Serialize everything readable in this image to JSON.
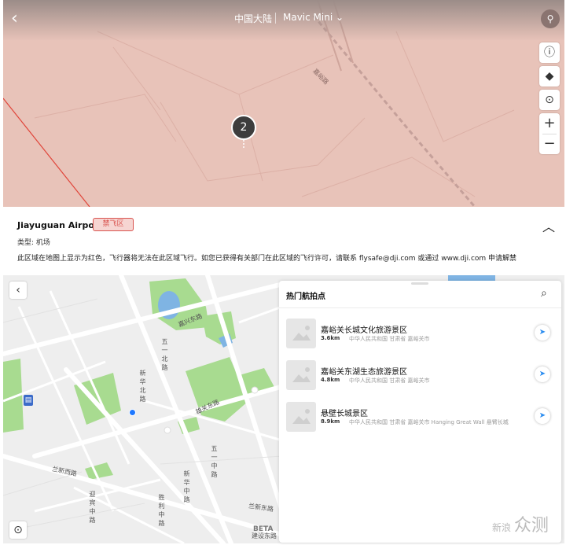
{
  "header": {
    "region": "中国大陆",
    "model": "Mavic Mini"
  },
  "top_map": {
    "cluster_count": "2",
    "road_label": "嘉峪路",
    "tools": [
      "info-icon",
      "layers-icon",
      "locate-icon",
      "zoom-in-icon",
      "zoom-out-icon"
    ],
    "zone_color": "#e7c2b8",
    "boundary_color": "#e0453a"
  },
  "info_panel": {
    "name": "Jiayuguan Airport",
    "badge": "禁飞区",
    "type_label": "类型:",
    "type_value": "机场",
    "description": "此区域在地图上显示为红色，飞行器将无法在此区域飞行。如您已获得有关部门在此区域的飞行许可，请联系 flysafe@dji.com 或通过 www.dji.com 申请解禁"
  },
  "bottom_map": {
    "roads": {
      "xingquan": "嘉兴东路",
      "wuyi_north": "五一北路",
      "xinhua_north": "新华北路",
      "jianguan": "雄关东路",
      "wuyi_middle": "五一中路",
      "xinhua_middle": "新华中路",
      "lanxin_west": "兰新西路",
      "shengli_middle": "胜利中路",
      "jiabin_middle": "迎宾中路",
      "lanxin_east": "兰新东路",
      "jianshe_east": "建设东路"
    },
    "beta_label": "BETA"
  },
  "hot_spots": {
    "title": "热门航拍点",
    "items": [
      {
        "name": "嘉峪关长城文化旅游景区",
        "distance": "3.6km",
        "location": "中华人民共和国 甘肃省 嘉峪关市"
      },
      {
        "name": "嘉峪关东湖生态旅游景区",
        "distance": "4.8km",
        "location": "中华人民共和国 甘肃省 嘉峪关市"
      },
      {
        "name": "悬壁长城景区",
        "distance": "8.9km",
        "location": "中华人民共和国 甘肃省 嘉峪关市 Hanging Great Wall 悬臂长城"
      }
    ]
  },
  "watermark": {
    "small": "新",
    "small2": "浪",
    "big": "众测"
  }
}
